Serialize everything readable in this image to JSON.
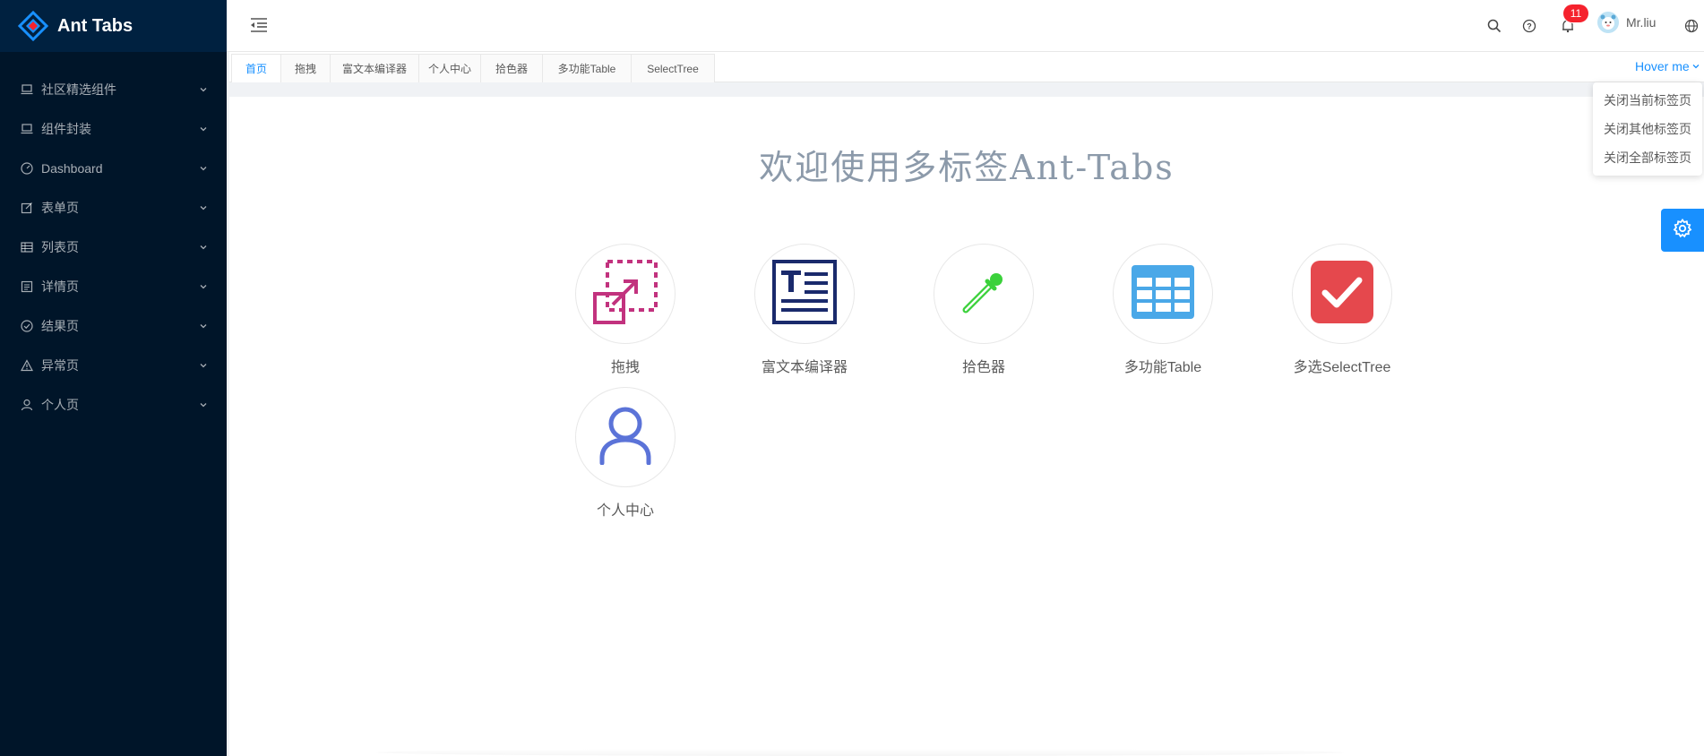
{
  "app": {
    "title": "Ant Tabs"
  },
  "sidebar": {
    "items": [
      {
        "label": "社区精选组件",
        "icon": "laptop-icon"
      },
      {
        "label": "组件封装",
        "icon": "laptop-icon"
      },
      {
        "label": "Dashboard",
        "icon": "dashboard-icon"
      },
      {
        "label": "表单页",
        "icon": "form-icon"
      },
      {
        "label": "列表页",
        "icon": "table-icon"
      },
      {
        "label": "详情页",
        "icon": "profile-icon"
      },
      {
        "label": "结果页",
        "icon": "check-circle-icon"
      },
      {
        "label": "异常页",
        "icon": "warning-icon"
      },
      {
        "label": "个人页",
        "icon": "user-icon"
      }
    ]
  },
  "header": {
    "notification_count": "11",
    "username": "Mr.liu",
    "icons": [
      "menu-fold-icon",
      "search-icon",
      "question-circle-icon",
      "bell-icon",
      "global-icon"
    ]
  },
  "tabs": {
    "items": [
      "首页",
      "拖拽",
      "富文本编译器",
      "个人中心",
      "拾色器",
      "多功能Table",
      "SelectTree"
    ],
    "active_index": 0,
    "hover_label": "Hover me"
  },
  "dropdown": {
    "items": [
      "关闭当前标签页",
      "关闭其他标签页",
      "关闭全部标签页"
    ]
  },
  "main": {
    "welcome": "欢迎使用多标签Ant-Tabs",
    "shortcuts": [
      {
        "label": "拖拽",
        "icon": "drag-icon"
      },
      {
        "label": "富文本编译器",
        "icon": "text-editor-icon"
      },
      {
        "label": "拾色器",
        "icon": "eyedropper-icon"
      },
      {
        "label": "多功能Table",
        "icon": "table-grid-icon"
      },
      {
        "label": "多选SelectTree",
        "icon": "checkbox-icon"
      },
      {
        "label": "个人中心",
        "icon": "person-icon"
      }
    ]
  },
  "colors": {
    "sidebar_bg": "#001529",
    "logo_bg": "#002140",
    "primary": "#1890ff",
    "badge": "#f5222d",
    "drag_icon": "#c2327e",
    "editor_icon": "#1a2a6c",
    "eyedropper_icon": "#3bd13b",
    "table_icon": "#4aa8e8",
    "checkbox_icon": "#e5484d",
    "person_icon": "#5b73d8"
  }
}
